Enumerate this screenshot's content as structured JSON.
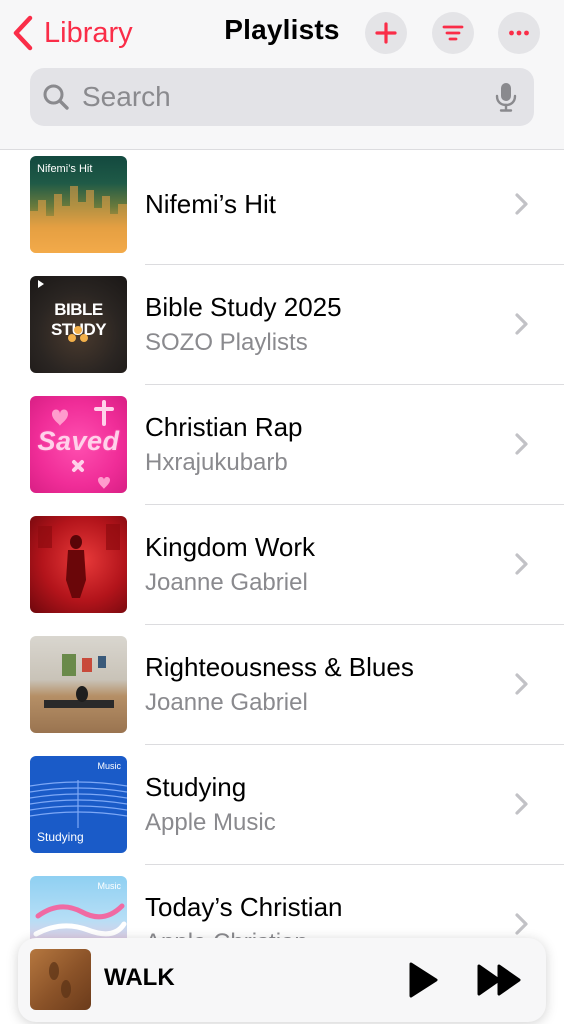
{
  "header": {
    "back_label": "Library",
    "title": "Playlists",
    "accent_color": "#fa2d48"
  },
  "icons": {
    "back": "chevron-left-icon",
    "add": "plus-icon",
    "sort": "sort-lines-icon",
    "more": "ellipsis-icon",
    "search": "magnifying-glass-icon",
    "mic": "microphone-icon",
    "row": "chevron-right-icon",
    "play": "play-icon",
    "forward": "fast-forward-icon"
  },
  "search": {
    "placeholder": "Search",
    "value": ""
  },
  "playlists": [
    {
      "title": "Nifemi’s Hit",
      "subtitle": "",
      "art_text": "Nifemi’s Hit"
    },
    {
      "title": "Bible Study 2025",
      "subtitle": "SOZO Playlists",
      "art_text": "BIBLE STUDY"
    },
    {
      "title": "Christian Rap",
      "subtitle": "Hxrajukubarb",
      "art_text": "Saved"
    },
    {
      "title": "Kingdom Work",
      "subtitle": "Joanne Gabriel",
      "art_text": ""
    },
    {
      "title": "Righteousness & Blues",
      "subtitle": "Joanne Gabriel",
      "art_text": ""
    },
    {
      "title": "Studying",
      "subtitle": "Apple Music",
      "art_text": "Studying",
      "badge": "Music"
    },
    {
      "title": "Today’s Christian",
      "subtitle": "Apple Christian",
      "art_text": "",
      "badge": "Music"
    }
  ],
  "now_playing": {
    "title": "WALK"
  }
}
